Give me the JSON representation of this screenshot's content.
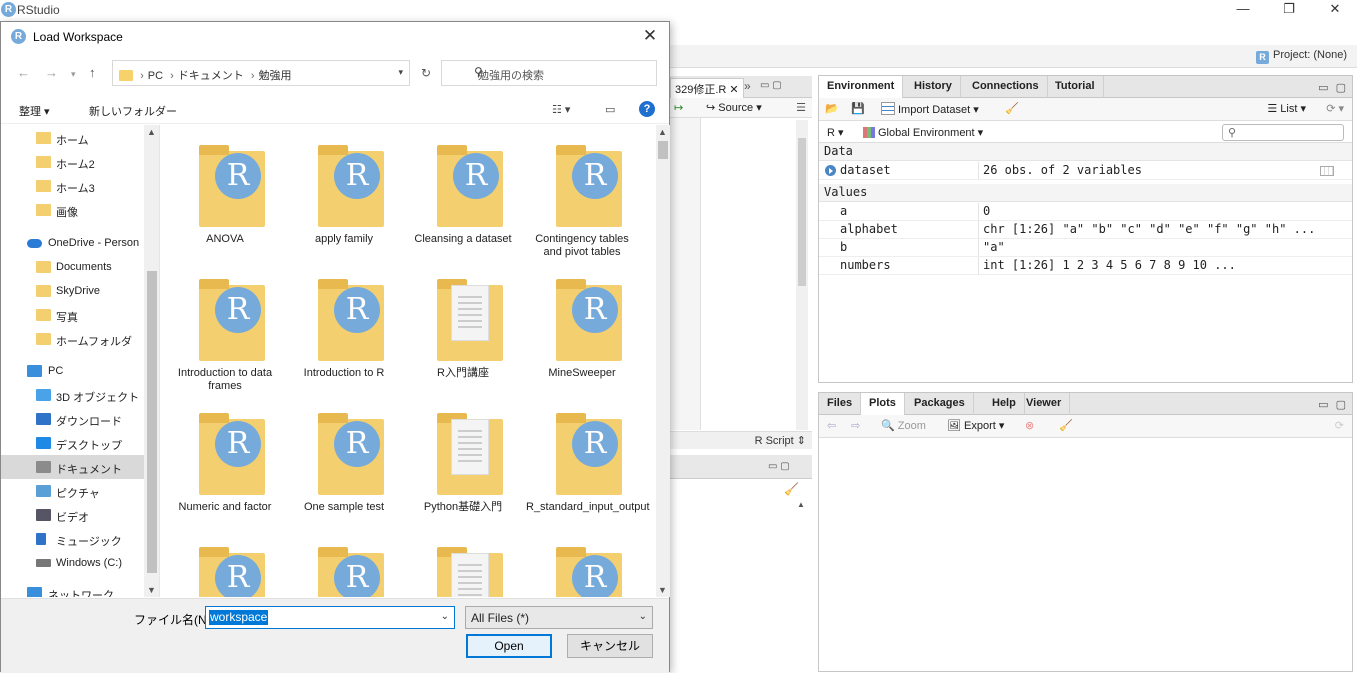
{
  "app": {
    "title": "RStudio",
    "project": "Project: (None)"
  },
  "editor": {
    "tab": "329修正.R",
    "source_label": "Source",
    "script_type": "R Script"
  },
  "environment": {
    "tabs": [
      "Environment",
      "History",
      "Connections",
      "Tutorial"
    ],
    "import_label": "Import Dataset",
    "list_label": "List",
    "lang": "R",
    "scope": "Global Environment",
    "sections": {
      "data": "Data",
      "values": "Values"
    },
    "data_rows": [
      {
        "name": "dataset",
        "value": "26 obs. of 2 variables"
      }
    ],
    "value_rows": [
      {
        "name": "a",
        "value": "0"
      },
      {
        "name": "alphabet",
        "value": "chr [1:26] \"a\" \"b\" \"c\" \"d\" \"e\" \"f\" \"g\" \"h\" ..."
      },
      {
        "name": "b",
        "value": "\"a\""
      },
      {
        "name": "numbers",
        "value": "int [1:26] 1 2 3 4 5 6 7 8 9 10 ..."
      }
    ]
  },
  "files_pane": {
    "tabs": [
      "Files",
      "Plots",
      "Packages",
      "Help",
      "Viewer"
    ],
    "zoom_label": "Zoom",
    "export_label": "Export"
  },
  "dialog": {
    "title": "Load Workspace",
    "breadcrumbs": [
      "PC",
      "ドキュメント",
      "勉強用"
    ],
    "search_placeholder": "勉強用の検索",
    "organize_label": "整理",
    "new_folder_label": "新しいフォルダー",
    "nav_items": [
      {
        "label": "ホーム"
      },
      {
        "label": "ホーム2"
      },
      {
        "label": "ホーム3"
      },
      {
        "label": "画像"
      },
      {
        "label": "OneDrive - Person"
      },
      {
        "label": "Documents"
      },
      {
        "label": "SkyDrive"
      },
      {
        "label": "写真"
      },
      {
        "label": "ホームフォルダ"
      },
      {
        "label": "PC"
      },
      {
        "label": "3D オブジェクト"
      },
      {
        "label": "ダウンロード"
      },
      {
        "label": "デスクトップ"
      },
      {
        "label": "ドキュメント"
      },
      {
        "label": "ピクチャ"
      },
      {
        "label": "ビデオ"
      },
      {
        "label": "ミュージック"
      },
      {
        "label": "Windows (C:)"
      },
      {
        "label": "ネットワーク"
      }
    ],
    "files": [
      "ANOVA",
      "apply family",
      "Cleansing a dataset",
      "Contingency tables and pivot tables",
      "Introduction to data frames",
      "Introduction to R",
      "R入門講座",
      "MineSweeper",
      "Numeric and factor",
      "One sample test",
      "Python基礎入門",
      "R_standard_input_output",
      "",
      "",
      "",
      ""
    ],
    "filename_label": "ファイル名(N):",
    "filename_value": "workspace",
    "filetype_value": "All Files (*)",
    "open_label": "Open",
    "cancel_label": "キャンセル"
  }
}
